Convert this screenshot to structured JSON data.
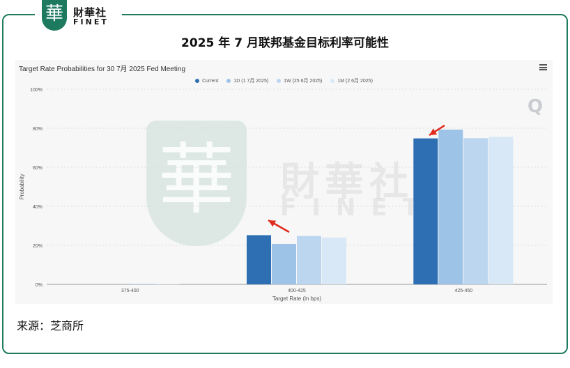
{
  "logo": {
    "badge_char": "華",
    "cn": "財華社",
    "en": "FINET"
  },
  "main_title": "2025 年 7 月联邦基金目标利率可能性",
  "chart_data": {
    "type": "bar",
    "title": "Target Rate Probabilities for 30 7月 2025 Fed Meeting",
    "xlabel": "Target Rate (in bps)",
    "ylabel": "Probability",
    "categories": [
      "375-400",
      "400-425",
      "425-450"
    ],
    "series": [
      {
        "name": "Current",
        "color": "#2e6fb4",
        "values": [
          0.0,
          25.2,
          74.8
        ]
      },
      {
        "name": "1D (1 7月 2025)",
        "color": "#9dc3e7",
        "values": [
          0.0,
          20.7,
          79.3
        ]
      },
      {
        "name": "1W (25 6月 2025)",
        "color": "#bcd6ef",
        "values": [
          0.3,
          24.8,
          74.9
        ]
      },
      {
        "name": "1M (2 6月 2025)",
        "color": "#d9e8f6",
        "values": [
          0.2,
          24.0,
          75.6
        ]
      }
    ],
    "yticks": [
      "0%",
      "20%",
      "40%",
      "60%",
      "80%",
      "100%"
    ],
    "ylim": [
      0,
      100
    ],
    "grid": true,
    "legend_position": "top-center"
  },
  "watermark": {
    "cn": "財華社",
    "en": "FINET",
    "badge_char": "華"
  },
  "q_mark": "Q",
  "source": "来源：芝商所"
}
